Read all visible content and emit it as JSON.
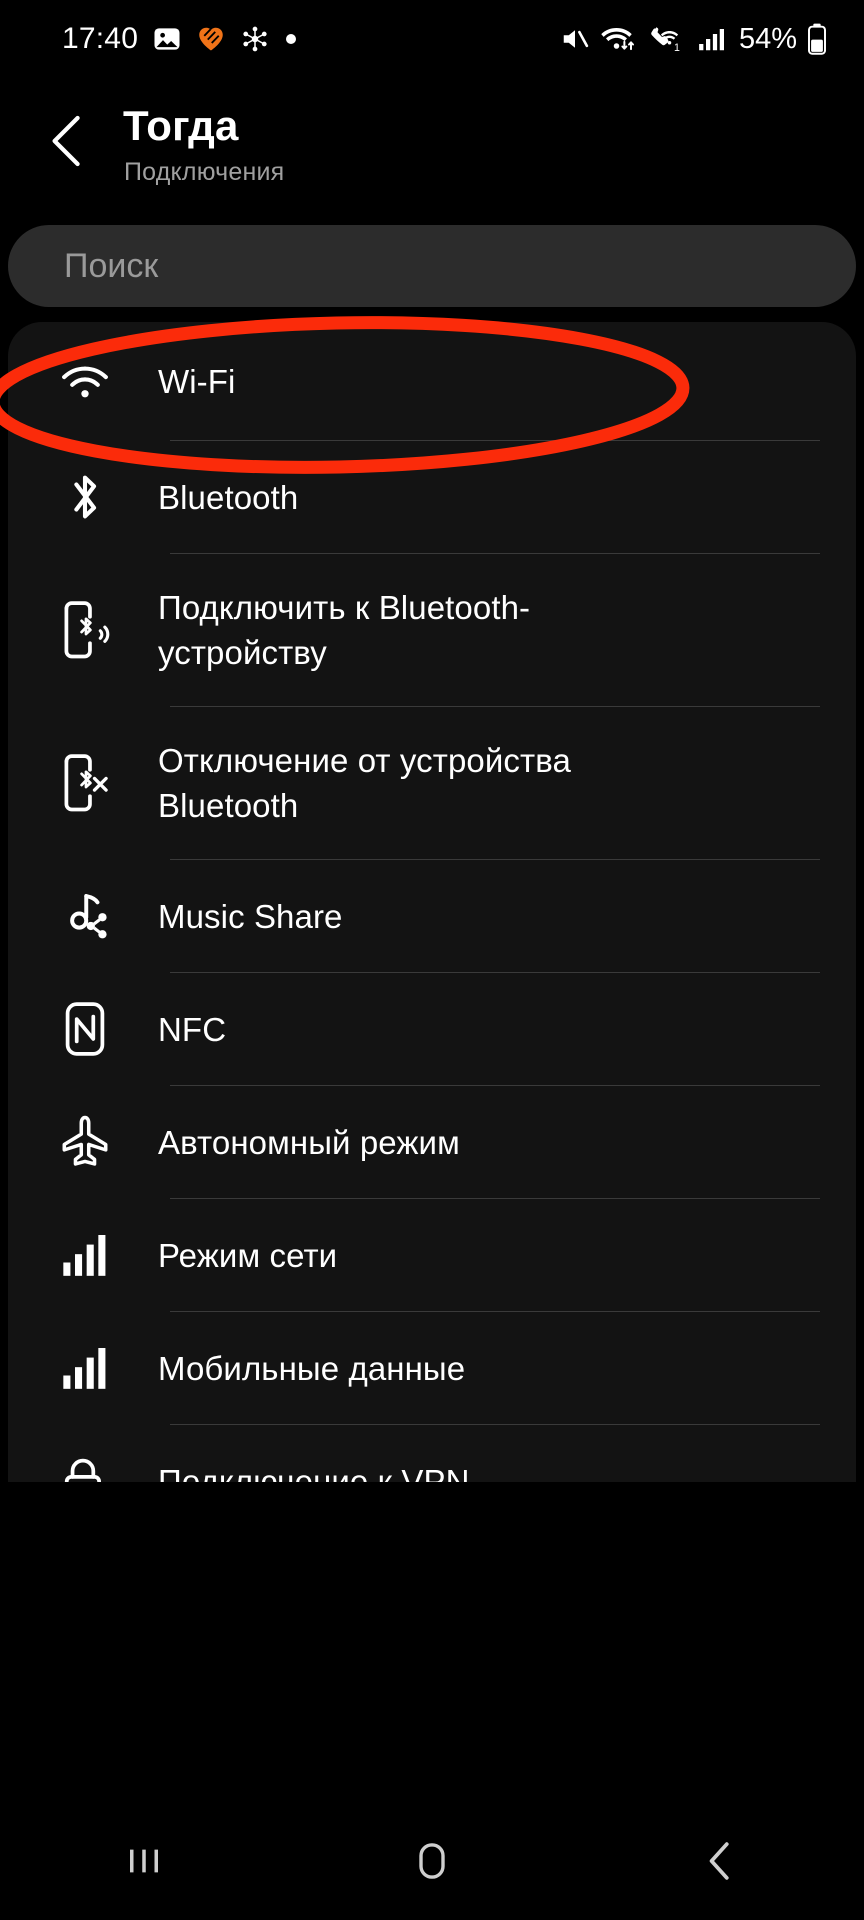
{
  "status_bar": {
    "time": "17:40",
    "battery_percent": "54%",
    "left_icons": [
      "gallery-icon",
      "heart-orange-icon",
      "smartthings-icon",
      "dot-icon"
    ],
    "right_icons": [
      "mute-icon",
      "wifi-data-icon",
      "vowifi-call-icon",
      "signal-bars-icon",
      "battery-icon"
    ],
    "colors": {
      "heart": "#F07318",
      "text": "#FFFFFF"
    }
  },
  "header": {
    "back_icon": "back-chevron-icon",
    "title": "Тогда",
    "subtitle": "Подключения"
  },
  "search": {
    "placeholder": "Поиск",
    "value": ""
  },
  "list": {
    "items": [
      {
        "label": "Wi-Fi",
        "icon": "wifi-icon",
        "highlighted": true
      },
      {
        "label": "Bluetooth",
        "icon": "bluetooth-icon",
        "highlighted": false
      },
      {
        "label": "Подключить к Bluetooth-устройству",
        "icon": "phone-bluetooth-connect-icon",
        "highlighted": false
      },
      {
        "label": "Отключение от устройства Bluetooth",
        "icon": "phone-bluetooth-disconnect-icon",
        "highlighted": false
      },
      {
        "label": "Music Share",
        "icon": "music-share-icon",
        "highlighted": false
      },
      {
        "label": "NFC",
        "icon": "nfc-icon",
        "highlighted": false
      },
      {
        "label": "Автономный режим",
        "icon": "airplane-icon",
        "highlighted": false
      },
      {
        "label": "Режим сети",
        "icon": "signal-bars-icon",
        "highlighted": false
      },
      {
        "label": "Мобильные данные",
        "icon": "signal-bars-icon",
        "highlighted": false
      },
      {
        "label": "Подключение к VPN",
        "icon": "vpn-lock-icon",
        "highlighted": false
      }
    ]
  },
  "annotation": {
    "shape": "ellipse",
    "target": "Wi-Fi",
    "color": "#FB2B0A"
  },
  "nav_bar": {
    "buttons": [
      {
        "name": "recents-button",
        "icon": "recents-icon"
      },
      {
        "name": "home-button",
        "icon": "home-icon"
      },
      {
        "name": "back-button",
        "icon": "back-icon"
      }
    ]
  }
}
